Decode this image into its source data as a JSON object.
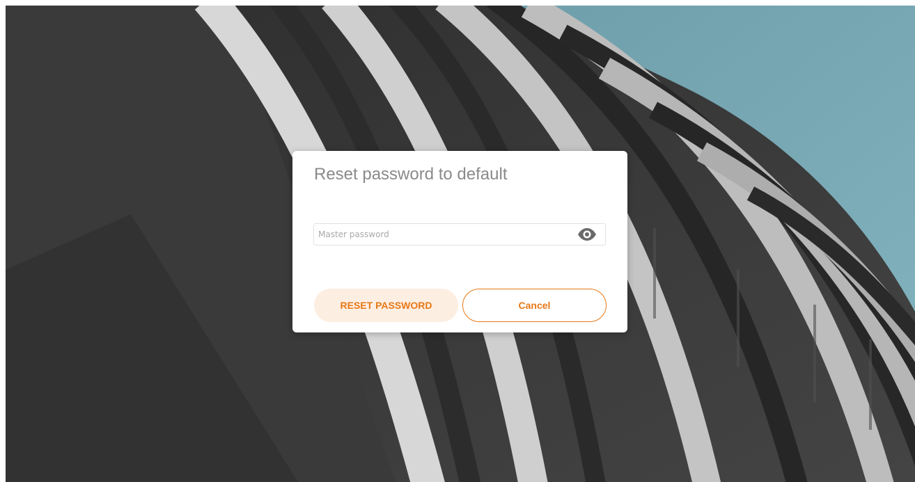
{
  "dialog": {
    "title": "Reset password to default",
    "password_field": {
      "value": "",
      "placeholder": "Master password",
      "toggle_icon": "eye-icon"
    },
    "reset_button_label": "RESET PASSWORD",
    "cancel_button_label": "Cancel"
  },
  "colors": {
    "accent": "#e77817",
    "primary_button_bg": "#fdeee2",
    "title_text": "#8a8a8a",
    "sky": "#6fa2ae"
  }
}
